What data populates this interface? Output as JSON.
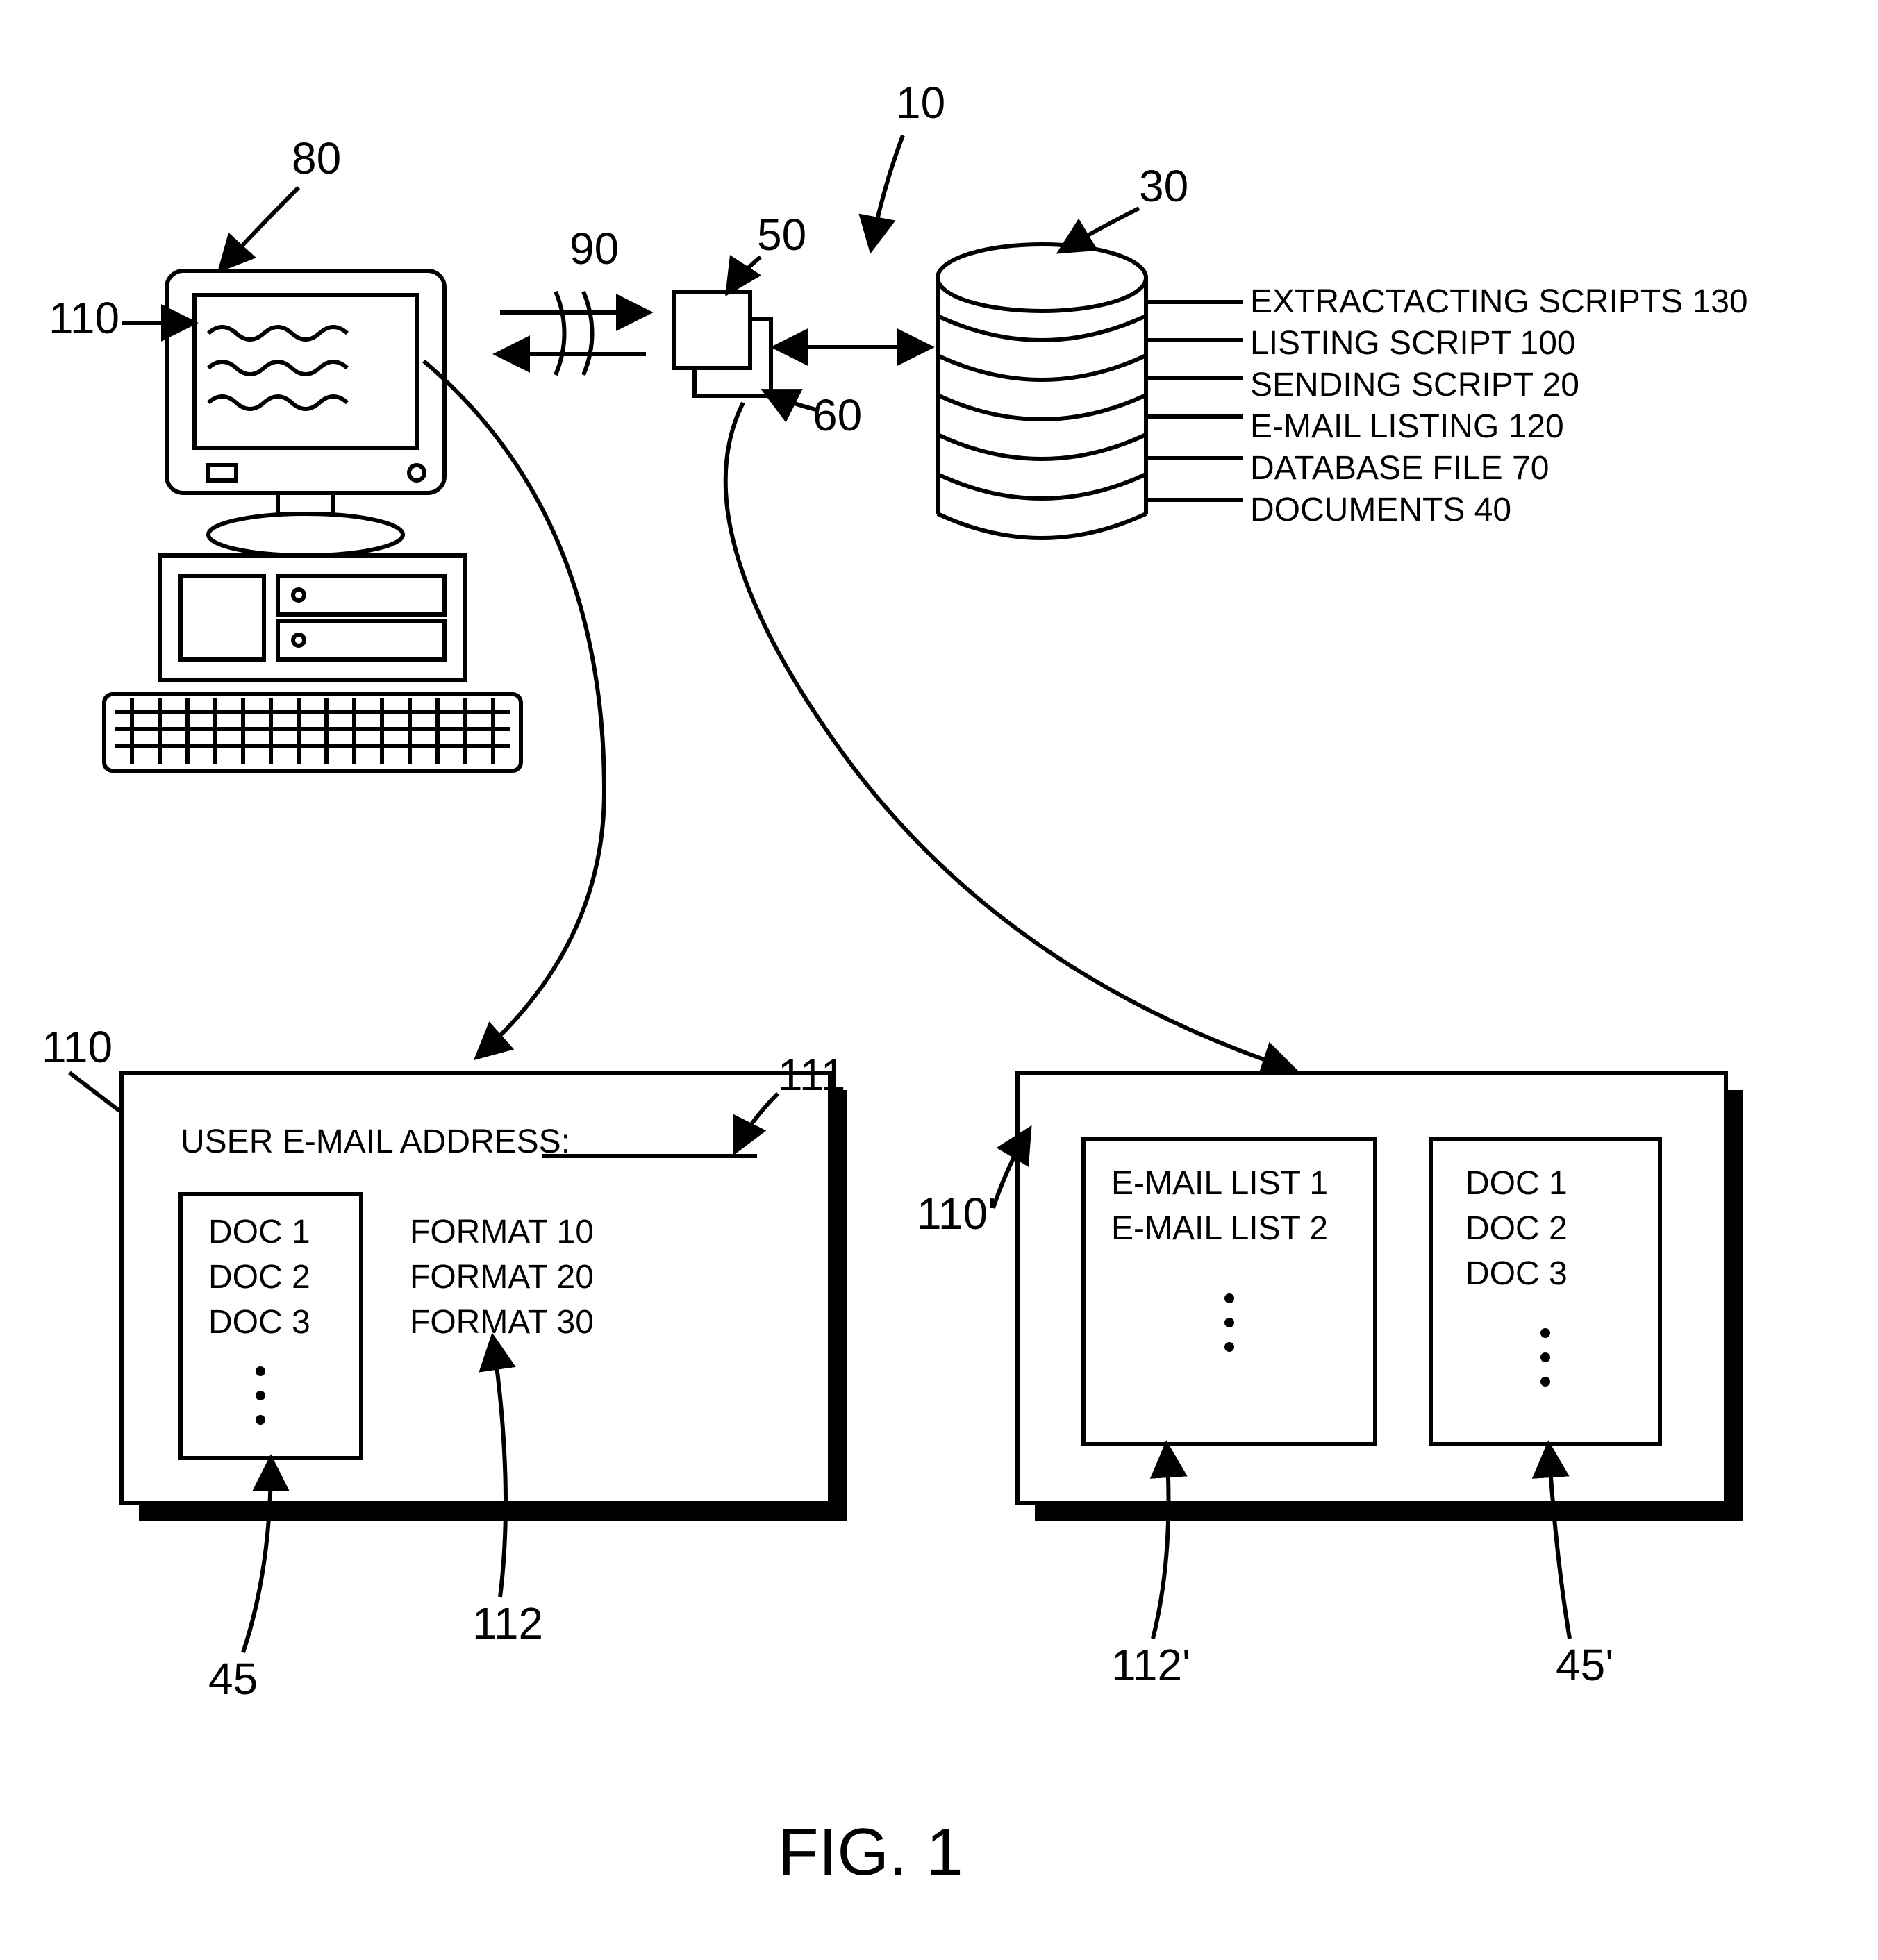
{
  "figure_label": "FIG. 1",
  "refs": {
    "system": "10",
    "sending_script": "20",
    "database": "30",
    "documents": "40",
    "doc_list_box": "45",
    "doc_list_box_prime": "45'",
    "server_front": "50",
    "server_back": "60",
    "database_file": "70",
    "computer": "80",
    "network": "90",
    "listing_script": "100",
    "webpage": "110",
    "webpage_prime": "110'",
    "email_field": "111",
    "format_list": "112",
    "email_list_box": "112'",
    "email_listing": "120",
    "extracting_scripts": "130"
  },
  "db_layers": {
    "l0": "EXTRACTACTING SCRIPTS 130",
    "l1": "LISTING SCRIPT 100",
    "l2": "SENDING SCRIPT 20",
    "l3": "E-MAIL LISTING 120",
    "l4": "DATABASE FILE 70",
    "l5": "DOCUMENTS 40"
  },
  "webpage_left": {
    "email_label": "USER E-MAIL ADDRESS:",
    "docs": {
      "d1": "DOC 1",
      "d2": "DOC 2",
      "d3": "DOC 3"
    },
    "formats": {
      "f1": "FORMAT 10",
      "f2": "FORMAT 20",
      "f3": "FORMAT 30"
    }
  },
  "webpage_right": {
    "emails": {
      "e1": "E-MAIL LIST 1",
      "e2": "E-MAIL LIST 2"
    },
    "docs": {
      "d1": "DOC 1",
      "d2": "DOC 2",
      "d3": "DOC 3"
    }
  }
}
